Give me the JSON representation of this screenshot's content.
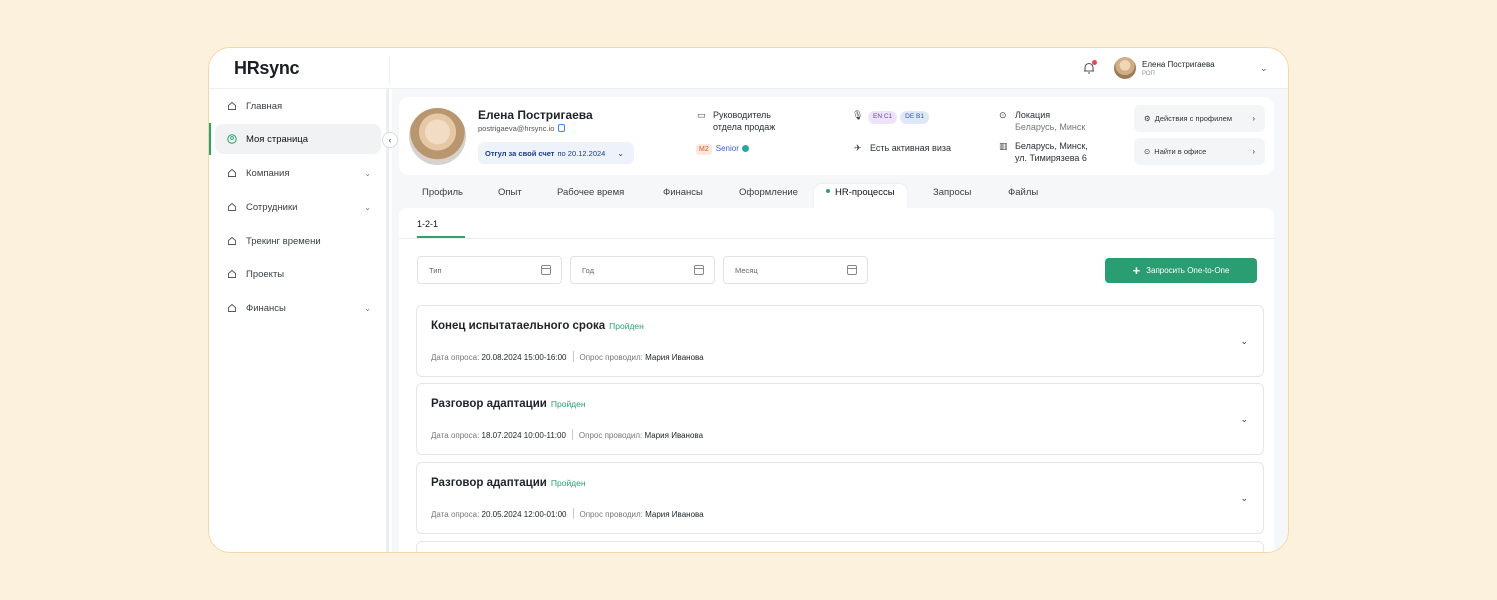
{
  "app": {
    "logo": "HRsync"
  },
  "header": {
    "user_name": "Елена Постригаева",
    "user_role": "РОП"
  },
  "sidebar": {
    "items": [
      {
        "label": "Главная",
        "icon": "home-icon",
        "active": false,
        "has_chevron": false
      },
      {
        "label": "Моя страница",
        "icon": "user-circle-icon",
        "active": true,
        "has_chevron": false
      },
      {
        "label": "Компания",
        "icon": "home-icon",
        "active": false,
        "has_chevron": true
      },
      {
        "label": "Сотрудники",
        "icon": "home-icon",
        "active": false,
        "has_chevron": true
      },
      {
        "label": "Трекинг времени",
        "icon": "home-icon",
        "active": false,
        "has_chevron": false
      },
      {
        "label": "Проекты",
        "icon": "home-icon",
        "active": false,
        "has_chevron": false
      },
      {
        "label": "Финансы",
        "icon": "home-icon",
        "active": false,
        "has_chevron": true
      }
    ]
  },
  "profile": {
    "name": "Елена Постригаева",
    "email": "postrigaeva@hrsync.io",
    "vacation_prefix": "Отгул за свой счет",
    "vacation_date": "по 20.12.2024",
    "position_line1": "Руководитель",
    "position_line2": "отдела продаж",
    "grade_badge": "M2",
    "grade": "Senior",
    "languages": [
      "EN  C1",
      "DE  B1"
    ],
    "visa": "Есть активная виза",
    "location_label": "Локация",
    "location_value": "Беларусь, Минск",
    "office_line1": "Беларусь, Минск,",
    "office_line2": "ул. Тимирязева 6",
    "actions_button": "Действия с профилем",
    "office_button": "Найти в офисе"
  },
  "tabs": [
    "Профиль",
    "Опыт",
    "Рабочее время",
    "Финансы",
    "Оформление",
    "HR-процессы",
    "Запросы",
    "Файлы"
  ],
  "active_tab": "HR-процессы",
  "subtab": "1-2-1",
  "filters": {
    "type": "Тип",
    "year": "Год",
    "month": "Месяц"
  },
  "request_button": "Запросить One-to-One",
  "cards": [
    {
      "title": "Конец испытатаельного срока",
      "status": "Пройден",
      "date_label": "Дата опроса:",
      "date": "20.08.2024 15:00-16:00",
      "by_label": "Опрос проводил:",
      "by": "Мария Иванова"
    },
    {
      "title": "Разговор адаптации",
      "status": "Пройден",
      "date_label": "Дата опроса:",
      "date": "18.07.2024 10:00-11:00",
      "by_label": "Опрос проводил:",
      "by": "Мария Иванова"
    },
    {
      "title": "Разговор адаптации",
      "status": "Пройден",
      "date_label": "Дата опроса:",
      "date": "20.05.2024 12:00-01:00",
      "by_label": "Опрос проводил:",
      "by": "Мария Иванова"
    }
  ],
  "colors": {
    "accent": "#2aa36f",
    "button": "#2a9d73",
    "page_bg": "#fcf1dd"
  }
}
